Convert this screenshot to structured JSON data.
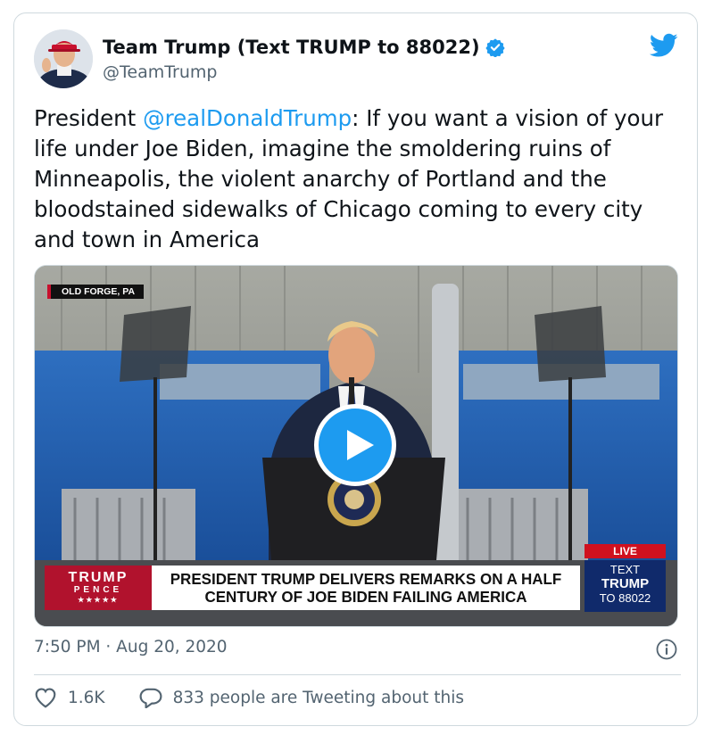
{
  "tweet": {
    "display_name": "Team Trump (Text TRUMP to 88022)",
    "handle": "@TeamTrump",
    "verified": true,
    "text_prefix": "President ",
    "mention": "@realDonaldTrump",
    "text_suffix": ": If you want a vision of your life under Joe Biden, imagine the smoldering ruins of Minneapolis, the violent anarchy of Portland and the bloodstained sidewalks of Chicago coming to every city and town in America",
    "timestamp": "7:50 PM · Aug 20, 2020"
  },
  "video": {
    "location_tag": "OLD FORGE, PA",
    "chyron_brand_line1": "TRUMP",
    "chyron_brand_line2": "PENCE",
    "chyron_brand_stars": "★★★★★",
    "headline_line1": "PRESIDENT TRUMP DELIVERS REMARKS ON A HALF",
    "headline_line2": "CENTURY OF JOE BIDEN FAILING AMERICA",
    "live_label": "LIVE",
    "text_box_line1": "TEXT",
    "text_box_line2": "TRUMP",
    "text_box_line3": "TO 88022"
  },
  "engagement": {
    "likes": "1.6K",
    "replies_label": "833 people are Tweeting about this"
  },
  "icons": {
    "brand": "twitter-bird-icon",
    "verified": "verified-badge-icon",
    "play": "play-icon",
    "info": "info-icon",
    "like": "heart-icon",
    "reply": "speech-bubble-icon"
  },
  "colors": {
    "accent": "#1d9bf0",
    "text": "#0f1419",
    "muted": "#536471",
    "border": "#cfd9de",
    "chyron_red": "#b1122d",
    "chyron_blue": "#102a6b"
  }
}
